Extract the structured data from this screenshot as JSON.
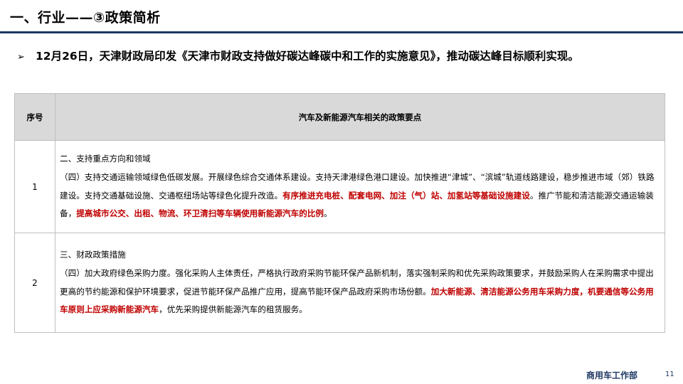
{
  "header": {
    "title": "一、行业——③政策简析"
  },
  "subtitle": {
    "bullet": "➢",
    "text": "12月26日，天津财政局印发《天津市财政支持做好碳达峰碳中和工作的实施意见》，推动碳达峰目标顺利实现。"
  },
  "table": {
    "headers": [
      "序号",
      "汽车及新能源汽车相关的政策要点"
    ],
    "rows": [
      {
        "num": "1",
        "section": "二、支持重点方向和领域",
        "segments": [
          "（四）支持交通运输领域绿色低碳发展。开展绿色综合交通体系建设。支持天津港绿色港口建设。加快推进“津城”、“滨城”轨道线路建设，稳步推进市域（郊）铁路建设。支持交通基础设施、交通枢纽场站等绿色化提升改造。",
          "有序推进充电桩、配套电网、加注（气）站、加氢站等基础设施建设",
          "。推广节能和清洁能源交通运输装备，",
          "提高城市公交、出租、物流、环卫清扫等车辆使用新能源汽车的比例",
          "。"
        ]
      },
      {
        "num": "2",
        "section": "三、财政政策措施",
        "segments": [
          "（四）加大政府绿色采购力度。强化采购人主体责任，严格执行政府采购节能环保产品新机制，落实强制采购和优先采购政策要求，并鼓励采购人在采购需求中提出更高的节约能源和保护环境要求，促进节能环保产品推广应用，提高节能环保产品政府采购市场份额。",
          "加大新能源、清洁能源公务用车采购力度，机要通信等公务用车原则上应采购新能源汽车",
          "，优先采购提供新能源汽车的租赁服务。"
        ]
      }
    ]
  },
  "footer": {
    "department": "商用车工作部",
    "page": "11"
  },
  "colors": {
    "accent": "#1f3864",
    "highlight": "#c00000",
    "header_bg": "#d9d9d9"
  }
}
